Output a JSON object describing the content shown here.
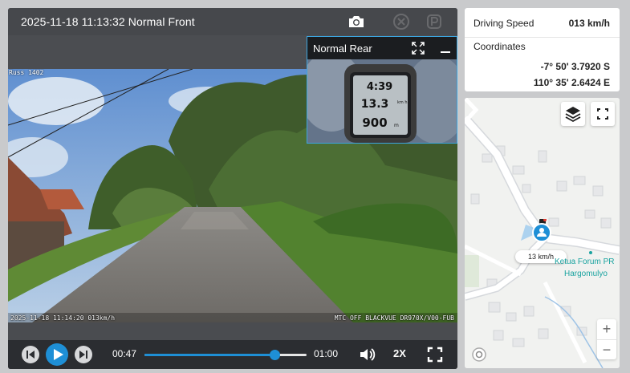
{
  "player": {
    "title": "2025-11-18 11:13:32 Normal Front",
    "front_osd_bottom_left": "2025-11-18 11:14:20 013km/h",
    "front_osd_bottom_right": "MTC OFF BLACKVUE DR970X/V00-FUB",
    "front_osd_top_left": "Russ 1402",
    "rear_label": "Normal Rear",
    "rear_meter": {
      "time": "4:39",
      "speed": "13.3",
      "speed_unit": "km h",
      "distance": "900",
      "distance_unit": "m"
    },
    "current_time": "00:47",
    "duration": "01:00",
    "progress_fraction": 0.8,
    "playback_rate": "2X",
    "icons": {
      "snapshot": "camera-icon",
      "disabled_1": "event-icon",
      "disabled_2": "parking-icon",
      "prev": "skip-back-icon",
      "play": "play-icon",
      "next": "skip-forward-icon",
      "volume": "volume-icon",
      "fullscreen": "fullscreen-icon"
    }
  },
  "info": {
    "speed_label": "Driving Speed",
    "speed_value": "013 km/h",
    "coords_label": "Coordinates",
    "latitude": "-7° 50' 3.7920 S",
    "longitude": "110° 35' 2.6424 E"
  },
  "map": {
    "speed_tag": "13 km/h",
    "poi_line1": "Ketua Forum PR",
    "poi_line2": "Hargomulyo",
    "zoom_in": "+",
    "zoom_out": "−",
    "icons": {
      "layers": "layers-icon",
      "fullscreen": "map-fullscreen-icon",
      "vehicle": "vehicle-marker-icon",
      "attribution": "map-logo-icon"
    }
  },
  "colors": {
    "accent": "#1e8fd6",
    "panel": "#46484c",
    "control_bar": "#2b2d31",
    "poi_text": "#1aa3a0"
  }
}
